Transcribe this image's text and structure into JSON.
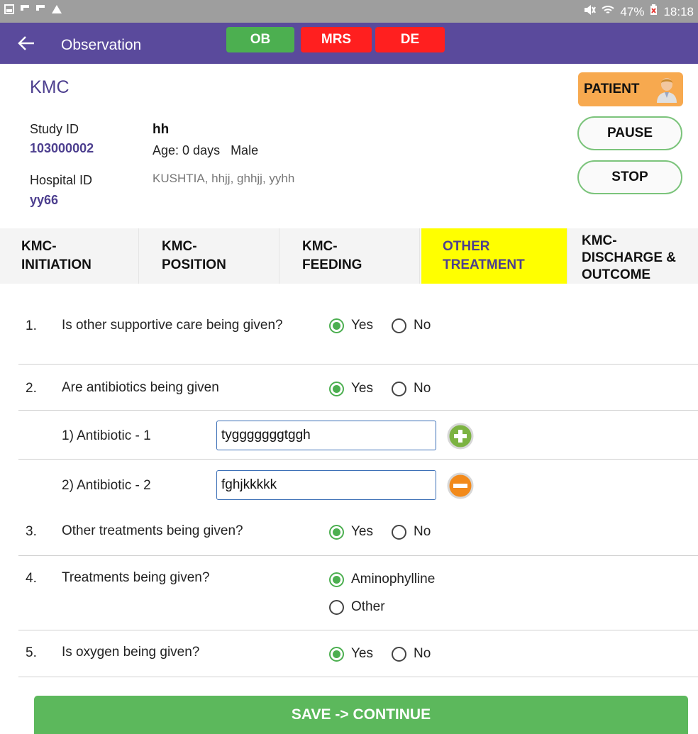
{
  "status_bar": {
    "left_icons": [
      "gallery-icon",
      "flipboard-icon",
      "flipboard-icon",
      "warning-icon"
    ],
    "battery": "47%",
    "time": "18:18"
  },
  "app_bar": {
    "title": "Observation",
    "chips": {
      "ob": "OB",
      "mrs": "MRS",
      "de": "DE"
    }
  },
  "header": {
    "section_title": "KMC",
    "study_id_label": "Study ID",
    "study_id": "103000002",
    "hospital_id_label": "Hospital ID",
    "hospital_id": "yy66",
    "name": "hh",
    "age_sex": "Age: 0 days   Male",
    "address": "KUSHTIA, hhjj, ghhjj, yyhh"
  },
  "actions": {
    "patient": "PATIENT",
    "pause": "PAUSE",
    "stop": "STOP"
  },
  "tabs": [
    {
      "line1": "KMC-",
      "line2": "INITIATION"
    },
    {
      "line1": "KMC-",
      "line2": "POSITION"
    },
    {
      "line1": "KMC-",
      "line2": "FEEDING"
    },
    {
      "line1": "OTHER",
      "line2": "TREATMENT"
    },
    {
      "line1": "KMC-",
      "line2": "DISCHARGE &",
      "line3": "OUTCOME"
    }
  ],
  "questions": [
    {
      "num": "1.",
      "text": "Is other supportive care being given?",
      "yes": "Yes",
      "no": "No"
    },
    {
      "num": "2.",
      "text": "Are antibiotics being given",
      "yes": "Yes",
      "no": "No"
    },
    {
      "num": "3.",
      "text": "Other treatments being given?",
      "yes": "Yes",
      "no": "No"
    },
    {
      "num": "4.",
      "text": "Treatments being given?",
      "opt1": "Aminophylline",
      "opt2": "Other"
    },
    {
      "num": "5.",
      "text": "Is oxygen being given?",
      "yes": "Yes",
      "no": "No"
    }
  ],
  "antibiotics": [
    {
      "label": "1) Antibiotic - 1",
      "value": "tygggggggtggh"
    },
    {
      "label": "2) Antibiotic - 2",
      "value": "fghjkkkkk"
    }
  ],
  "save_button": "SAVE -> CONTINUE",
  "colors": {
    "app_bar": "#5a4a9c",
    "accent_green": "#4caf50",
    "chip_red": "#ff1f1f",
    "active_tab": "#ffff00",
    "patient_button": "#f7a94f"
  }
}
